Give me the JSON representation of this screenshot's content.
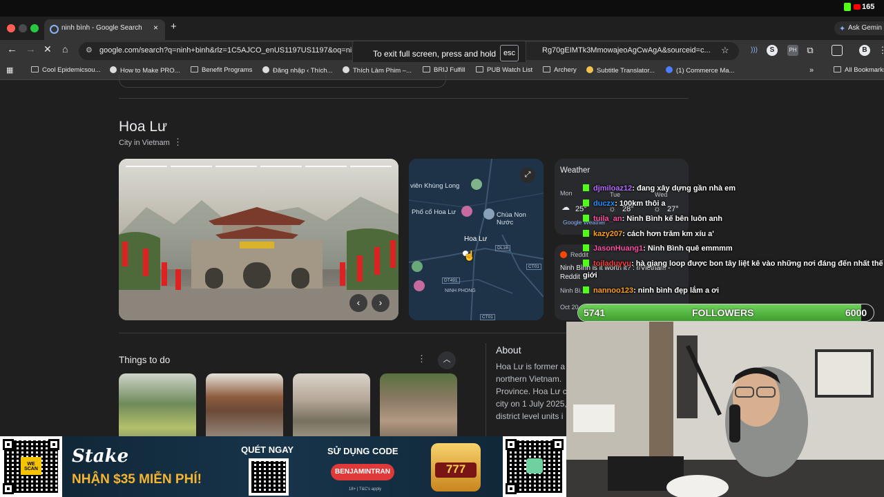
{
  "status": {
    "viewer_count": "165"
  },
  "tab": {
    "title": "ninh bình - Google Search",
    "close": "×",
    "new": "+"
  },
  "ask_gemini": "Ask Gemin",
  "omnibox": {
    "url": "google.com/search?q=ninh+binh&rlz=1C5AJCO_enUS1197US1197&oq=nin",
    "url_tail": "Rg70gEIMTk3MmowajeoAgCwAgA&sourceid=c..."
  },
  "fullscreen_notice": {
    "text": "To exit full screen, press and hold",
    "key": "esc"
  },
  "bookmarks": [
    "Cool Epidemicsou...",
    "How to Make PRO...",
    "Benefit Programs",
    "Đăng nhập ‹ Thích...",
    "Thích Làm Phim –...",
    "BRIJ Fulfill",
    "PUB Watch List",
    "Archery",
    "Subtitle Translator...",
    "(1) Commerce Ma...",
    "All Bookmarks"
  ],
  "place": {
    "title": "Hoa Lư",
    "subtitle": "City in Vietnam"
  },
  "map": {
    "labels": [
      "viên Khùng Long",
      "Phố cổ Hoa Lư",
      "Chùa Non Nước",
      "Hoa Lư",
      "NINH PHONG",
      "DL16",
      "CT01",
      "DT491",
      "CT01"
    ]
  },
  "weather": {
    "title": "Weather",
    "days": [
      "Mon",
      "Tue",
      "Wed"
    ],
    "temps": [
      "25°",
      "28°",
      "27°"
    ],
    "source": "Google Weather"
  },
  "reddit": {
    "source": "Reddit",
    "title": "Ninh Bình is it worth it? : r/Vietnam - Reddit",
    "snippet": "Ninh Bì...",
    "date": "Oct 20..."
  },
  "things": {
    "title": "Things to do"
  },
  "about": {
    "title": "About",
    "lines": [
      "Hoa Lư is former a",
      "northern Vietnam.",
      "Province. Hoa Lư c",
      "city on 1 July 2025,",
      "district level units i"
    ]
  },
  "chat": [
    {
      "user": "djmiloaz12",
      "text": ": đang xây dựng gần nhà em",
      "color": "#b36bff"
    },
    {
      "user": "duczx",
      "text": ": 100km thôi a",
      "color": "#1e90ff"
    },
    {
      "user": "tuila_an",
      "text": ": Ninh Bình kế bên luôn anh",
      "color": "#ff4fa3"
    },
    {
      "user": "kazy207",
      "text": ": cách hơn trăm km xíu a'",
      "color": "#ff9f1a"
    },
    {
      "user": "JasonHuang1",
      "text": ": Ninh Bình quê emmmm",
      "color": "#ff4fa3"
    },
    {
      "user": "toiladuyvu",
      "text": ": hà giang loop được bon tây liệt kê vào những nơi đáng đến nhất thế",
      "color": "#ff3b3b"
    },
    {
      "user": "",
      "text": "giới",
      "color": "#ffffff"
    },
    {
      "user": "nannoo123",
      "text": ": ninh bình đẹp lắm a ơi",
      "color": "#ff9f1a"
    }
  ],
  "followers": {
    "current": "5741",
    "label": "FOLLOWERS",
    "goal": "6000",
    "progress": 0.957
  },
  "ad": {
    "brand": "Stake",
    "offer": "NHẬN $35 MIỄN PHÍ!",
    "scan": "QUÉT NGAY",
    "use_code": "SỬ DỤNG CODE",
    "code": "BENJAMINTRAN",
    "slot": "777",
    "fine_print": "18+ | T&C's apply",
    "qr_brand": "WE SCAN"
  },
  "colors": {
    "accent": "#53fc18",
    "chrome": "#353535",
    "page": "#1f1f1f"
  }
}
